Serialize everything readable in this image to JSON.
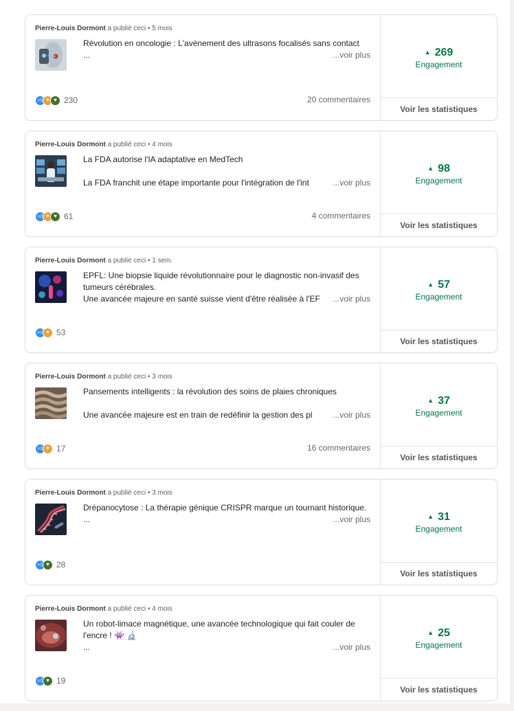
{
  "meta_suffix": "a publié ceci",
  "voir_plus": "...voir plus",
  "engagement_label": "Engagement",
  "stats_button": "Voir les statistiques",
  "colors": {
    "engagement": "#057642",
    "like": "#378fe9",
    "celebrate": "#e7a33e",
    "support": "#44712e"
  },
  "posts": [
    {
      "author": "Pierre-Louis Dormont",
      "time": "5 mois",
      "title": "Révolution en oncologie : L'avènement des ultrasons focalisés sans contact",
      "excerpt": "...",
      "reactions_count": "230",
      "reaction_icons": [
        "like-icon",
        "celebrate-icon",
        "support-icon"
      ],
      "comments": "20 commentaires",
      "engagement": "269",
      "thumb": "ultrasound-device-thumbnail"
    },
    {
      "author": "Pierre-Louis Dormont",
      "time": "4 mois",
      "title": "La FDA autorise l'IA adaptative en MedTech",
      "excerpt": "La FDA franchit une étape importante pour l'intégration de l'int",
      "reactions_count": "61",
      "reaction_icons": [
        "like-icon",
        "celebrate-icon",
        "support-icon"
      ],
      "comments": "4 commentaires",
      "engagement": "98",
      "thumb": "ai-lab-thumbnail"
    },
    {
      "author": "Pierre-Louis Dormont",
      "time": "1 sem.",
      "title": "EPFL: Une biopsie liquide révolutionnaire pour le diagnostic non-invasif des tumeurs cérébrales.",
      "excerpt": "Une avancée majeure en santé suisse vient d'être réalisée à l'EF",
      "reactions_count": "53",
      "reaction_icons": [
        "like-icon",
        "celebrate-icon"
      ],
      "comments": "",
      "engagement": "57",
      "thumb": "liquid-biopsy-thumbnail"
    },
    {
      "author": "Pierre-Louis Dormont",
      "time": "3 mois",
      "title": "Pansements intelligents : la révolution des soins de plaies chroniques",
      "excerpt": "Une avancée majeure est en train de redéfinir la gestion des pl",
      "reactions_count": "17",
      "reaction_icons": [
        "like-icon",
        "celebrate-icon"
      ],
      "comments": "16 commentaires",
      "engagement": "37",
      "thumb": "smart-dressing-thumbnail"
    },
    {
      "author": "Pierre-Louis Dormont",
      "time": "3 mois",
      "title": "Drépanocytose : La thérapie génique CRISPR marque un tournant historique.",
      "excerpt": "...",
      "reactions_count": "28",
      "reaction_icons": [
        "like-icon",
        "support-icon"
      ],
      "comments": "",
      "engagement": "31",
      "thumb": "crispr-dna-thumbnail"
    },
    {
      "author": "Pierre-Louis Dormont",
      "time": "4 mois",
      "title": "Un robot-limace magnétique, une avancée technologique qui fait couler de l'encre ! 👾 🔬",
      "excerpt": "...",
      "reactions_count": "19",
      "reaction_icons": [
        "like-icon",
        "support-icon"
      ],
      "comments": "",
      "engagement": "25",
      "thumb": "robot-slug-thumbnail"
    }
  ]
}
